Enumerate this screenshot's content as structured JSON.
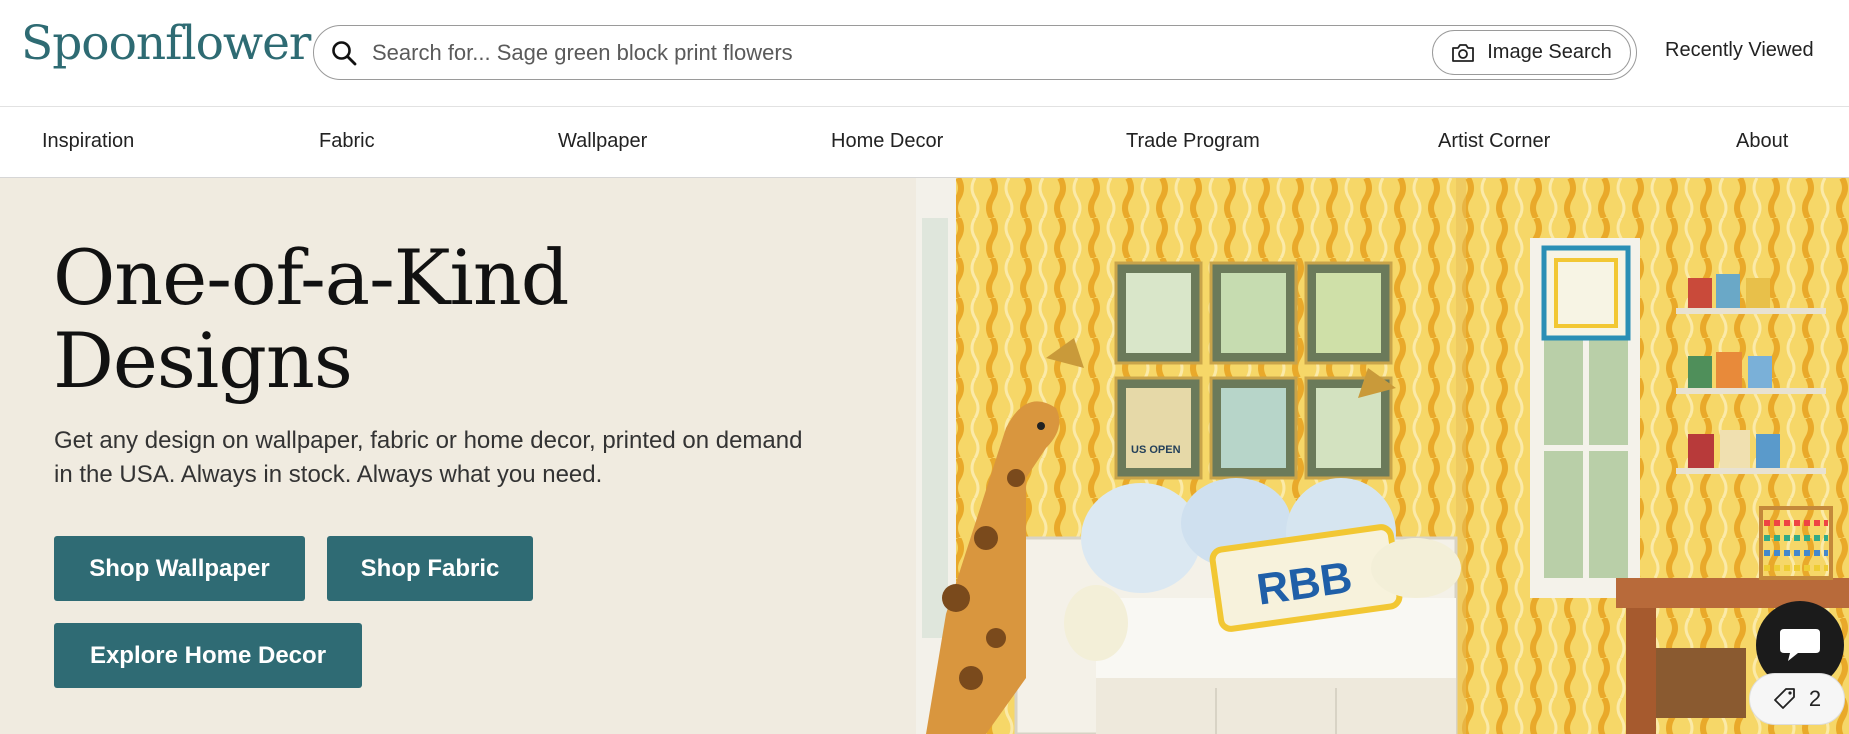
{
  "header": {
    "logo": "Spoonflower",
    "search": {
      "placeholder": "Search for... Sage green block print flowers",
      "value": ""
    },
    "image_search_label": "Image Search",
    "recently_viewed_label": "Recently Viewed"
  },
  "nav": {
    "items": [
      {
        "label": "Inspiration"
      },
      {
        "label": "Fabric"
      },
      {
        "label": "Wallpaper"
      },
      {
        "label": "Home Decor"
      },
      {
        "label": "Trade Program"
      },
      {
        "label": "Artist Corner"
      },
      {
        "label": "About"
      }
    ]
  },
  "hero": {
    "title": "One-of-a-Kind Designs",
    "subtitle": "Get any design on wallpaper, fabric or home decor, printed on demand in the USA. Always in stock. Always what you need.",
    "buttons": {
      "shop_wallpaper": "Shop Wallpaper",
      "shop_fabric": "Shop Fabric",
      "explore_home_decor": "Explore Home Decor"
    },
    "image": {
      "pillow_text": "RBB",
      "poster_text": "US OPEN"
    }
  },
  "widgets": {
    "cart_count": "2"
  },
  "colors": {
    "brand_teal": "#2f6b74",
    "hero_bg": "#f0ebe0",
    "wallpaper_yellow": "#f3c94a"
  }
}
